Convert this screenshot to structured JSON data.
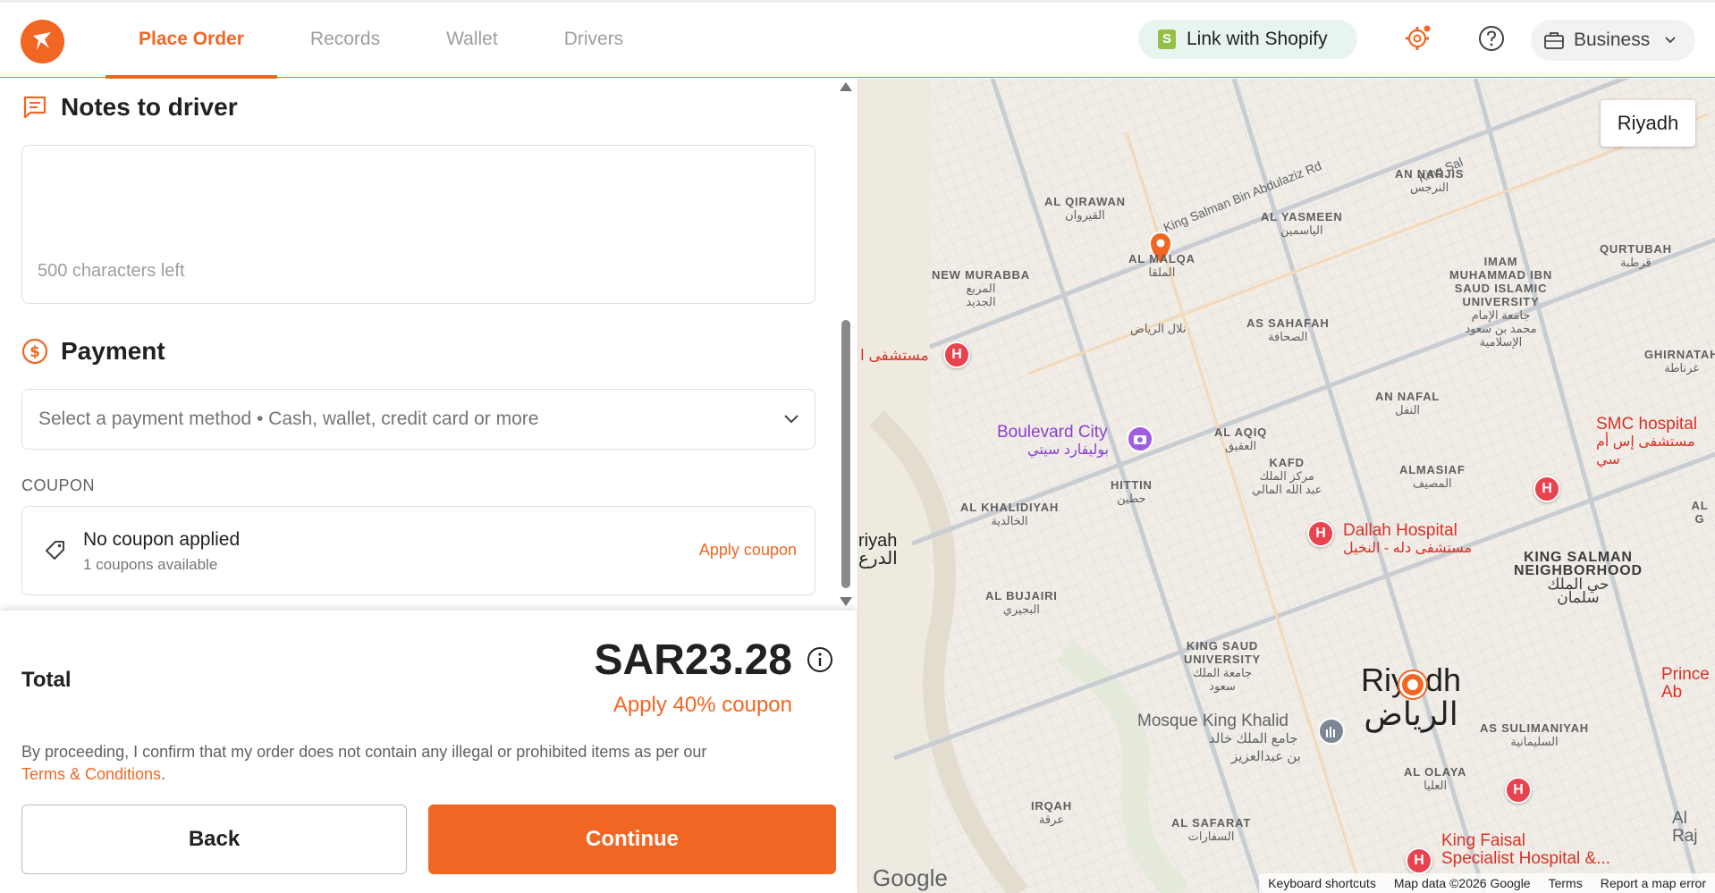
{
  "header": {
    "tabs": [
      {
        "label": "Place Order",
        "active": true
      },
      {
        "label": "Records",
        "active": false
      },
      {
        "label": "Wallet",
        "active": false
      },
      {
        "label": "Drivers",
        "active": false
      }
    ],
    "shopify_label": "Link with Shopify",
    "business_label": "Business",
    "icons": [
      "logo-bird-icon",
      "settings-gear-icon",
      "help-icon",
      "briefcase-icon",
      "chevron-down-icon"
    ]
  },
  "notes": {
    "title": "Notes to driver",
    "chars_left": "500 characters left"
  },
  "payment": {
    "title": "Payment",
    "placeholder": "Select a payment method • Cash, wallet, credit card or more"
  },
  "coupon": {
    "label": "COUPON",
    "title": "No coupon applied",
    "subtitle": "1 coupons available",
    "apply_label": "Apply coupon"
  },
  "summary": {
    "total_label": "Total",
    "total_amount": "SAR23.28",
    "coupon_hint": "Apply 40% coupon",
    "disclaimer": "By proceeding, I confirm that my order does not contain any illegal or prohibited items as per our",
    "terms_link": "Terms & Conditions",
    "terms_suffix": ".",
    "back_label": "Back",
    "continue_label": "Continue"
  },
  "map": {
    "city_button": "Riyadh",
    "labels": {
      "king_salman_rd": "King Salman Bin Abdulaziz Rd",
      "king_sal": "King Sal",
      "al_qirawan": "AL QIRAWAN",
      "al_qirawan_ar": "القيروان",
      "an_narjis": "AN NARJIS",
      "an_narjis_ar": "النرجس",
      "al_yasmeen": "AL YASMEEN",
      "al_yasmeen_ar": "الياسمين",
      "qurtubah": "QURTUBAH",
      "qurtubah_ar": "قرطبة",
      "al_malqa": "AL MALQA",
      "al_malqa_ar": "الملقا",
      "new_murabba_1": "NEW MURABBA",
      "new_murabba_ar_1": "المربع",
      "new_murabba_ar_2": "الجديد",
      "imam_1": "IMAM",
      "imam_2": "MUHAMMAD IBN",
      "imam_3": "SAUD ISLAMIC",
      "imam_4": "UNIVERSITY",
      "imam_ar_1": "جامعة الإمام",
      "imam_ar_2": "محمد بن سعود",
      "imam_ar_3": "الإسلامية",
      "nalal_riyadh_ar": "نلال الرياض",
      "as_sahafah": "AS SAHAFAH",
      "as_sahafah_ar": "الصحافة",
      "ghirnatah": "GHIRNATAH",
      "ghirnatah_ar": "غرناطة",
      "hospital_left": "مستشفى ا",
      "an_nafal": "AN NAFAL",
      "an_nafal_ar": "النفل",
      "smc_hospital": "SMC hospital",
      "smc_hospital_ar": "مستشفى إس أم سي",
      "boulevard_city": "Boulevard City",
      "boulevard_city_ar": "بوليفارد سيتي",
      "al_aqiq": "AL AQIQ",
      "al_aqiq_ar": "العقيق",
      "kafd": "KAFD",
      "kafd_ar_1": "مركز الملك",
      "kafd_ar_2": "عبد الله المالي",
      "hittin": "HITTIN",
      "hittin_ar": "حطين",
      "almasiaf": "ALMASIAF",
      "almasiaf_ar": "المصيف",
      "al_khalidiyah": "AL KHALIDIYAH",
      "al_khalidiyah_ar": "الخالدية",
      "al_g": "AL G",
      "riyah": "riyah",
      "riyah_ar": "الدرع",
      "dallah_hospital": "Dallah Hospital",
      "dallah_hospital_ar": "مستشفى دله - النخيل",
      "king_salman_nb_1": "KING SALMAN",
      "king_salman_nb_2": "NEIGHBORHOOD",
      "king_salman_nb_ar_1": "حي الملك",
      "king_salman_nb_ar_2": "سلمان",
      "al_bujairi": "AL BUJAIRI",
      "al_bujairi_ar": "البجيري",
      "ksu_1": "KING SAUD",
      "ksu_2": "UNIVERSITY",
      "ksu_ar_1": "جامعة الملك",
      "ksu_ar_2": "سعود",
      "prince_1": "Prince",
      "prince_2": "Ab",
      "city_en": "Riyadh",
      "city_ar": "الرياض",
      "mosque": "Mosque King Khalid",
      "mosque_ar_1": "جامع الملك خالد",
      "mosque_ar_2": "بن عبدالعزيز",
      "as_sulimaniyah": "AS SULIMANIYAH",
      "as_sulimaniyah_ar": "السليمانية",
      "al_olaya": "AL OLAYA",
      "al_olaya_ar": "العليا",
      "irqah": "IRQAH",
      "irqah_ar": "عرقة",
      "al_safarat": "AL SAFARAT",
      "al_safarat_ar": "السفارات",
      "al_raj": "Al Raj",
      "king_faisal_1": "King Faisal",
      "king_faisal_2": "Specialist Hospital &..."
    },
    "google": "Google",
    "footer": [
      "Keyboard shortcuts",
      "Map data ©2026 Google",
      "Terms",
      "Report a map error"
    ]
  },
  "colors": {
    "brand": "#f16622",
    "hospital": "#e8434f",
    "shopify_green": "#95bf47"
  }
}
